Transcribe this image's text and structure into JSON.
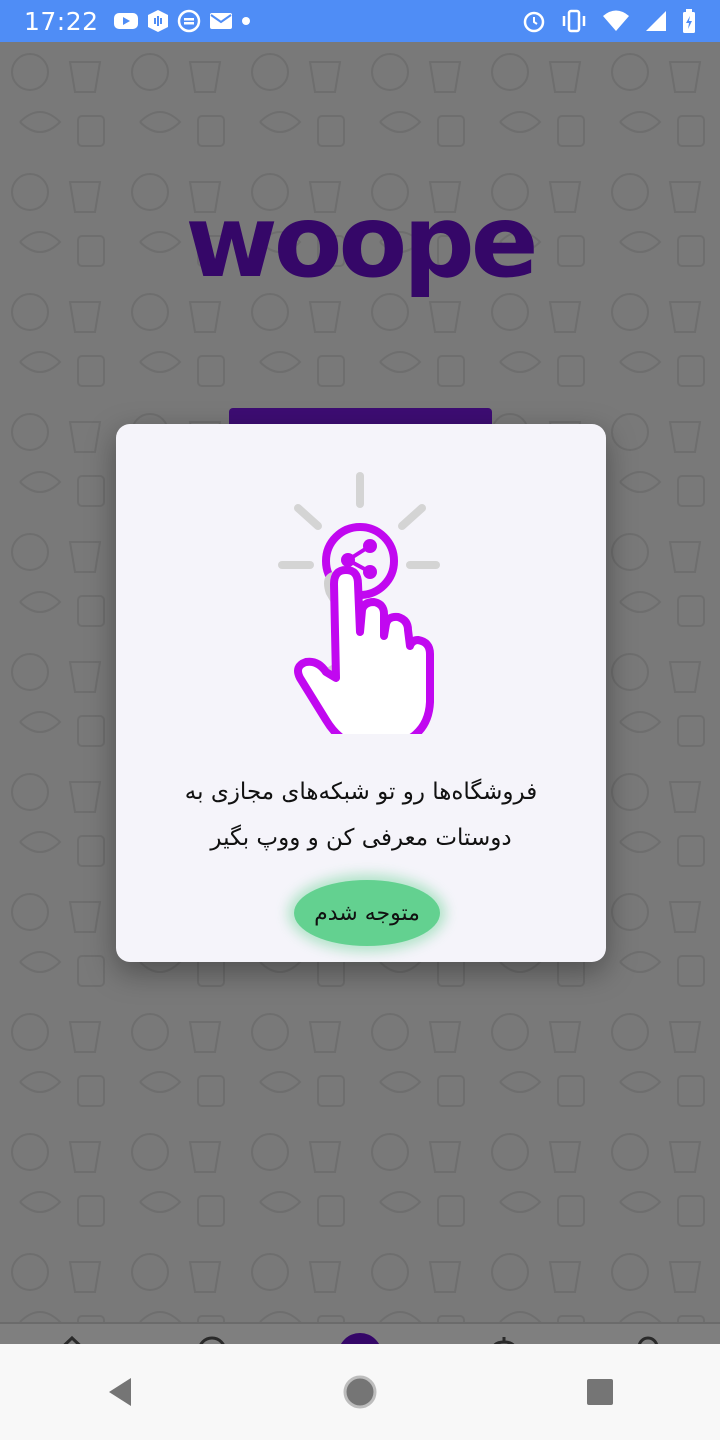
{
  "status_bar": {
    "time": "17:22",
    "left_icons": [
      "youtube-icon",
      "podcast-icon",
      "vpn-icon",
      "mail-icon",
      "dot-icon"
    ],
    "right_icons": [
      "alarm-icon",
      "vibrate-icon",
      "wifi-icon",
      "signal-icon",
      "battery-icon"
    ],
    "color": "#4f8df6"
  },
  "app": {
    "logo_text": "woope",
    "brand_color": "#6a0fd0"
  },
  "bottom_nav": {
    "items": [
      "home-icon",
      "search-icon",
      "woope-icon",
      "bell-icon",
      "profile-icon"
    ]
  },
  "dialog": {
    "illustration": "share-tap-icon",
    "message_line1": "فروشگاه‌ها رو تو شبکه‌های مجازی به",
    "message_line2": "دوستات معرفی کن و ووپ بگیر",
    "button_label": "متوجه شدم",
    "button_color": "#63d190",
    "accent_color": "#c108f0"
  },
  "system_nav": {
    "items": [
      "back-icon",
      "home-circle-icon",
      "recents-icon"
    ]
  }
}
